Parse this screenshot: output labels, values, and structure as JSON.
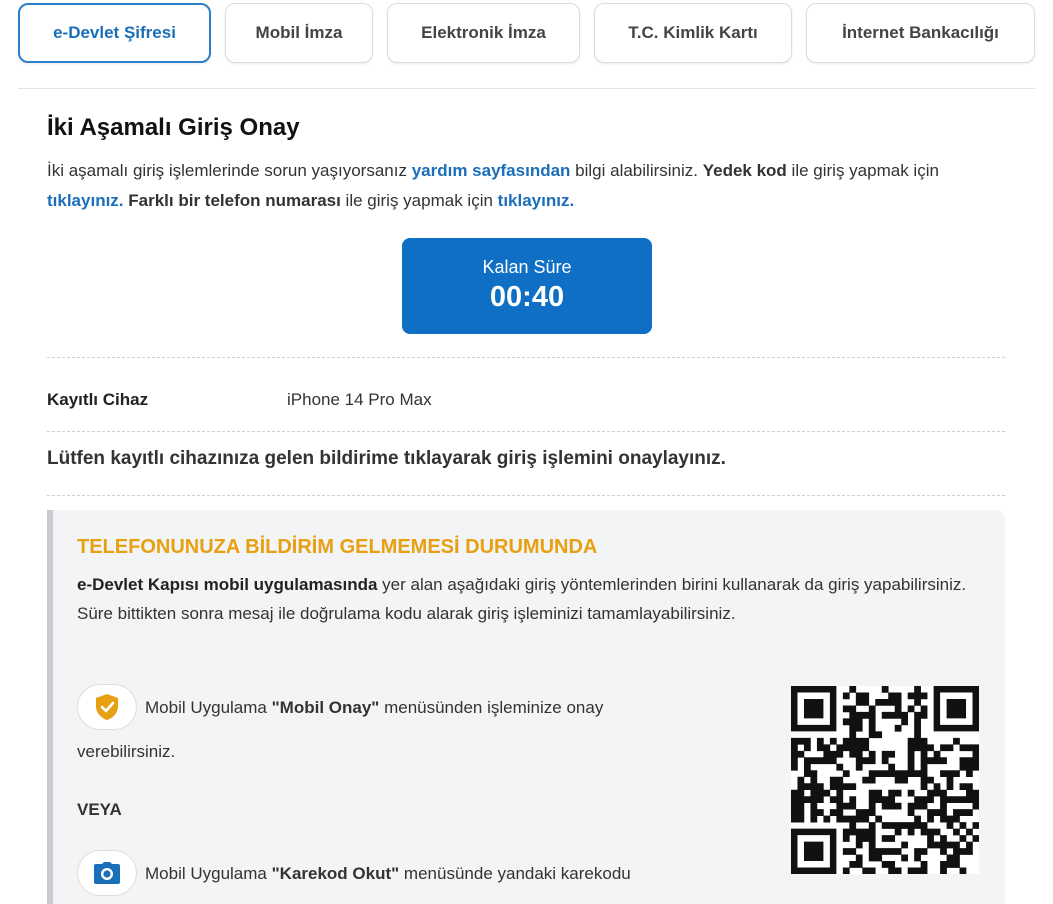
{
  "tabs": [
    {
      "label": "e-Devlet Şifresi",
      "active": true
    },
    {
      "label": "Mobil İmza",
      "active": false
    },
    {
      "label": "Elektronik İmza",
      "active": false
    },
    {
      "label": "T.C. Kimlik Kartı",
      "active": false
    },
    {
      "label": "İnternet Bankacılığı",
      "active": false
    }
  ],
  "main": {
    "title": "İki Aşamalı Giriş Onay",
    "intro": {
      "p1": "İki aşamalı giriş işlemlerinde sorun yaşıyorsanız ",
      "help_link": "yardım sayfasından",
      "p2": " bilgi alabilirsiniz. ",
      "backup_bold": "Yedek kod",
      "p3": " ile giriş yapmak için ",
      "backup_link": "tıklayınız.",
      "phone_bold": "Farklı bir telefon numarası",
      "p4": " ile giriş yapmak için ",
      "phone_link": "tıklayınız."
    },
    "timer": {
      "label": "Kalan Süre",
      "value": "00:40"
    },
    "device": {
      "label": "Kayıtlı Cihaz",
      "value": "iPhone 14 Pro Max"
    },
    "instruction": "Lütfen kayıtlı cihazınıza gelen bildirime tıklayarak giriş işlemini onaylayınız."
  },
  "notice": {
    "title": "TELEFONUNUZA BİLDİRİM GELMEMESİ DURUMUNDA",
    "text_bold": "e-Devlet Kapısı mobil uygulamasında",
    "text_rest": " yer alan aşağıdaki giriş yöntemlerinden birini kullanarak da giriş yapabilirsiniz. Süre bittikten sonra mesaj ile doğrulama kodu alarak giriş işleminizi tamamlayabilirsiniz.",
    "method1": {
      "icon": "shield-check-icon",
      "prefix": "Mobil Uygulama ",
      "bold": "\"Mobil Onay\"",
      "suffix": " menüsünden işleminize onay",
      "continuation": "verebilirsiniz."
    },
    "or_label": "VEYA",
    "method2": {
      "icon": "camera-icon",
      "prefix": "Mobil Uygulama ",
      "bold": "\"Karekod Okut\"",
      "suffix": " menüsünde yandaki karekodu"
    },
    "qr_icon": "qr-code-icon"
  },
  "colors": {
    "accent_blue": "#0e6fc4",
    "link_blue": "#1b6fba",
    "warning_orange": "#e8a013"
  }
}
